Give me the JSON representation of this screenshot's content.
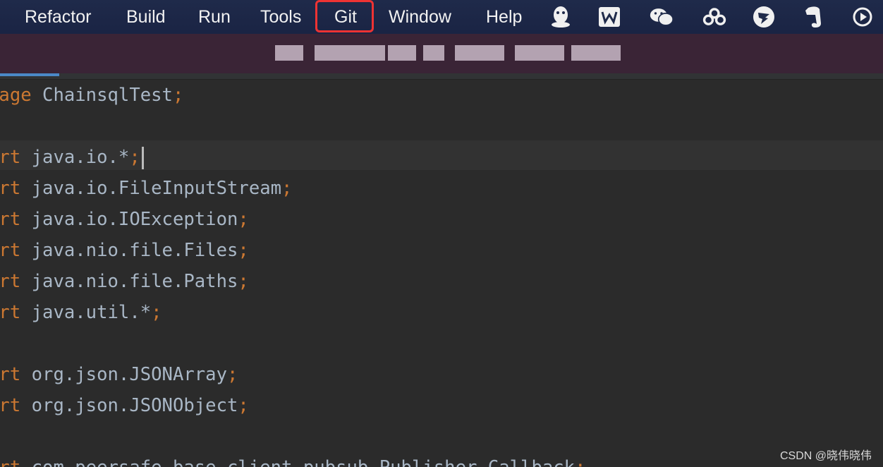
{
  "menubar": {
    "items": [
      {
        "label": "Refactor"
      },
      {
        "label": "Build"
      },
      {
        "label": "Run"
      },
      {
        "label": "Tools"
      },
      {
        "label": "Git"
      },
      {
        "label": "Window"
      },
      {
        "label": "Help"
      }
    ],
    "highlighted_item": "Git",
    "highlight_color": "#e53333",
    "tray_icons": [
      "qq-penguin-icon",
      "wps-office-icon",
      "wechat-icon",
      "baidu-netdisk-icon",
      "dingtalk-icon",
      "evernote-icon",
      "play-circle-icon"
    ]
  },
  "title_bar": {
    "background": "#3a2436",
    "title_obscured": true
  },
  "editor": {
    "lines": [
      {
        "keyword": "kage",
        "code": " ChainsqlTest",
        "semi": ";"
      },
      {
        "keyword": "",
        "code": "",
        "semi": ""
      },
      {
        "keyword": "ort",
        "code": " java.io.*",
        "semi": ";",
        "caret": true
      },
      {
        "keyword": "ort",
        "code": " java.io.FileInputStream",
        "semi": ";"
      },
      {
        "keyword": "ort",
        "code": " java.io.IOException",
        "semi": ";"
      },
      {
        "keyword": "ort",
        "code": " java.nio.file.Files",
        "semi": ";"
      },
      {
        "keyword": "ort",
        "code": " java.nio.file.Paths",
        "semi": ";"
      },
      {
        "keyword": "ort",
        "code": " java.util.*",
        "semi": ";"
      },
      {
        "keyword": "",
        "code": "",
        "semi": ""
      },
      {
        "keyword": "ort",
        "code": " org.json.JSONArray",
        "semi": ";"
      },
      {
        "keyword": "ort",
        "code": " org.json.JSONObject",
        "semi": ";"
      },
      {
        "keyword": "",
        "code": "",
        "semi": ""
      },
      {
        "keyword": "ort",
        "code": " com.peersafe.base.client.pubsub.Publisher.Callback",
        "semi": ";"
      }
    ],
    "keyword_color": "#cc7832",
    "text_color": "#a9b7c6",
    "background": "#2b2b2b"
  },
  "watermark": "CSDN @晓伟晓伟"
}
